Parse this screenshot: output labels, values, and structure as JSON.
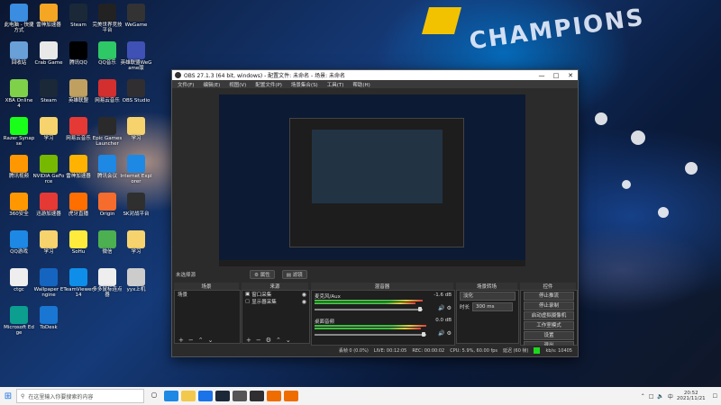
{
  "wallpaper": {
    "text": "CHAMPIONS"
  },
  "desktop": {
    "icons": [
      {
        "label": "此电脑 - 快捷方式",
        "color": "#3a8de0"
      },
      {
        "label": "雷神加速器",
        "color": "#f5a623"
      },
      {
        "label": "Steam",
        "color": "#1b2838"
      },
      {
        "label": "完美世界竞技平台",
        "color": "#222222"
      },
      {
        "label": "WeGame",
        "color": "#333333"
      },
      {
        "label": "回收站",
        "color": "#6aa0d8"
      },
      {
        "label": "Crab Game",
        "color": "#e8e8e8"
      },
      {
        "label": "腾讯QQ",
        "color": "#000000"
      },
      {
        "label": "QQ音乐",
        "color": "#2ec866"
      },
      {
        "label": "英雄联盟WeGame版",
        "color": "#3f51b5"
      },
      {
        "label": "XBA Online 4",
        "color": "#7fd14a"
      },
      {
        "label": "Steam",
        "color": "#1b2838"
      },
      {
        "label": "英雄联盟",
        "color": "#c0a060"
      },
      {
        "label": "网易云音乐",
        "color": "#d32f2f"
      },
      {
        "label": "OBS Studio",
        "color": "#302e31"
      },
      {
        "label": "Razer Synapse",
        "color": "#1aff1a"
      },
      {
        "label": "学习",
        "color": "#f7d36e"
      },
      {
        "label": "网易云音乐",
        "color": "#e53935"
      },
      {
        "label": "Epic Games Launcher",
        "color": "#2a2a2a"
      },
      {
        "label": "学习",
        "color": "#f7d36e"
      },
      {
        "label": "腾讯视频",
        "color": "#ff9800"
      },
      {
        "label": "NVIDIA GeForce",
        "color": "#76b900"
      },
      {
        "label": "雷神加速器",
        "color": "#ffb300"
      },
      {
        "label": "腾讯会议",
        "color": "#1e88e5"
      },
      {
        "label": "Internet Explorer",
        "color": "#1e88e5"
      },
      {
        "label": "360安全",
        "color": "#ff9800"
      },
      {
        "label": "迅游加速器",
        "color": "#e53935"
      },
      {
        "label": "虎牙直播",
        "color": "#ff6f00"
      },
      {
        "label": "Origin",
        "color": "#f56c2d"
      },
      {
        "label": "SK对战平台",
        "color": "#2f2f2f"
      },
      {
        "label": "QQ游戏",
        "color": "#1e88e5"
      },
      {
        "label": "学习",
        "color": "#f7d36e"
      },
      {
        "label": "SoHu",
        "color": "#ffeb3b"
      },
      {
        "label": "微信",
        "color": "#4caf50"
      },
      {
        "label": "学习",
        "color": "#f7d36e"
      },
      {
        "label": "ctgc",
        "color": "#eeeeee"
      },
      {
        "label": "Wallpaper Engine",
        "color": "#1565c0"
      },
      {
        "label": "TeamViewer 14",
        "color": "#0e8ee9"
      },
      {
        "label": "多多鼠标连点器",
        "color": "#eeeeee"
      },
      {
        "label": "yyx上机",
        "color": "#cccccc"
      },
      {
        "label": "Microsoft Edge",
        "color": "#0c9e8e"
      },
      {
        "label": "ToDesk",
        "color": "#1976d2"
      }
    ]
  },
  "obs": {
    "title": "OBS 27.1.3 (64 bit, windows) - 配置文件: 未命名 - 场景: 未命名",
    "menus": [
      "文件(F)",
      "编辑(E)",
      "视图(V)",
      "配置文件(P)",
      "场景集合(S)",
      "工具(T)",
      "帮助(H)"
    ],
    "no_source_label": "未选择源",
    "props_button": "属性",
    "filters_button": "滤镜",
    "panels": {
      "scenes": {
        "title": "场景",
        "items": [
          "场景"
        ]
      },
      "sources": {
        "title": "来源",
        "items": [
          "窗口采集",
          "显示器采集"
        ]
      },
      "mixer": {
        "title": "混音器",
        "channels": [
          {
            "label": "麦克风/Aux",
            "db": "-1.6 dB"
          },
          {
            "label": "桌面音频",
            "db": "0.0 dB"
          }
        ]
      },
      "transitions": {
        "title": "场景转场",
        "type": "淡化",
        "duration_label": "时长",
        "duration": "300 ms"
      },
      "controls": {
        "title": "控件",
        "buttons": [
          "停止推流",
          "停止录制",
          "启动虚拟摄像机",
          "工作室模式",
          "设置",
          "退出"
        ]
      }
    },
    "status": {
      "dropped": "丢帧 0 (0.0%)",
      "live": "LIVE: 00:12:05",
      "rec": "REC: 00:00:02",
      "cpu": "CPU: 5.9%, 60.00 fps",
      "kbps": "延迟 (60 帧)",
      "bitrate": "kb/s: 10405"
    }
  },
  "taskbar": {
    "search_placeholder": "在这里输入你要搜索的内容",
    "time": "20:52",
    "date": "2021/11/21"
  }
}
